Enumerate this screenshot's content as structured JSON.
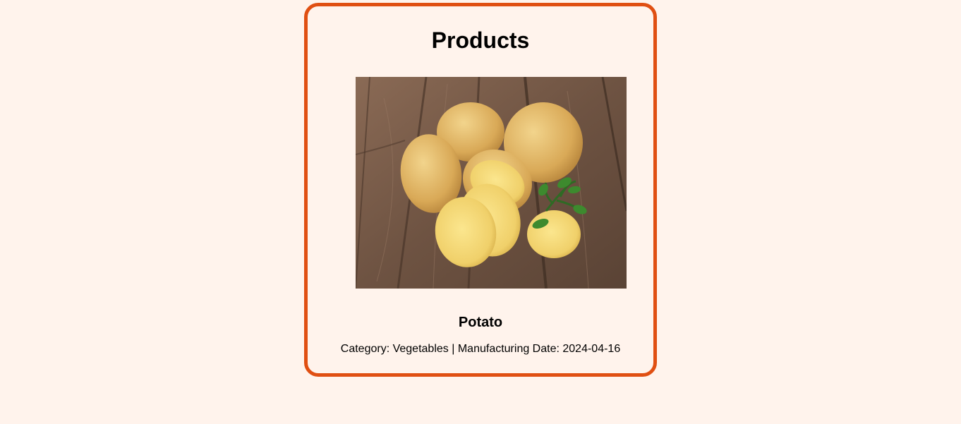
{
  "page": {
    "title": "Products"
  },
  "product": {
    "name": "Potato",
    "category_label": "Category:",
    "category": "Vegetables",
    "separator": "|",
    "date_label": "Manufacturing Date:",
    "manufacturing_date": "2024-04-16",
    "image": "potatoes-on-wooden-table-photo"
  },
  "colors": {
    "background": "#fff3ec",
    "card_border": "#e04f12"
  }
}
